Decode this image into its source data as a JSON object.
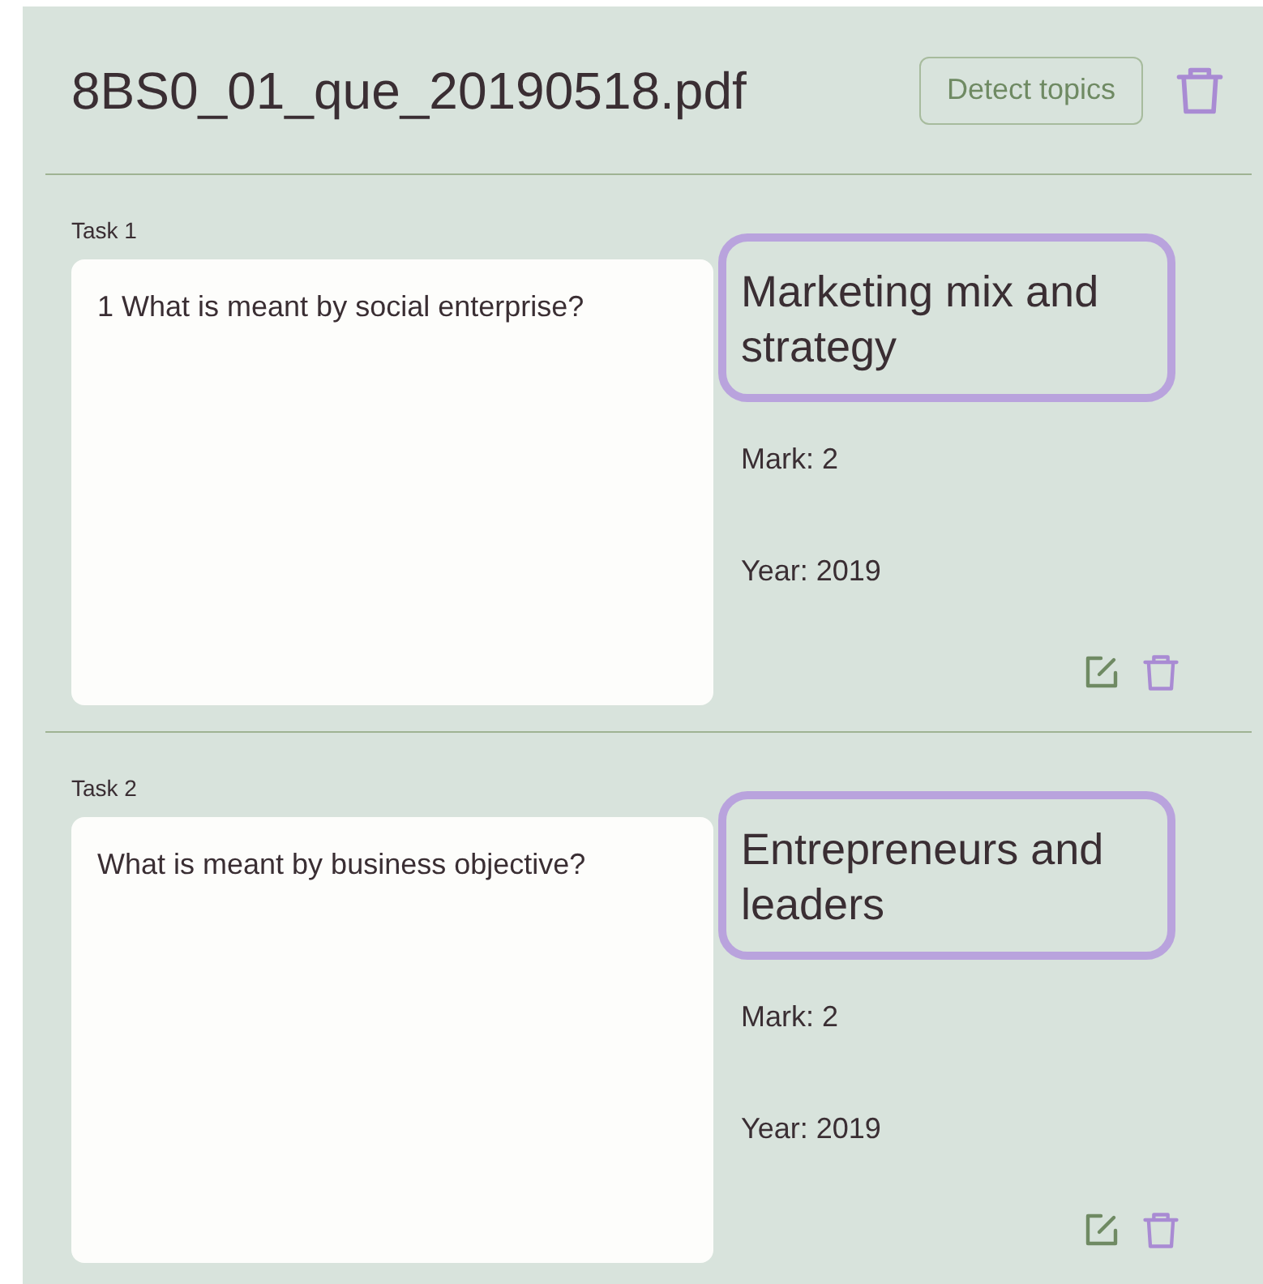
{
  "document": {
    "title": "8BS0_01_que_20190518.pdf",
    "detect_button": "Detect topics"
  },
  "tasks": [
    {
      "label": "Task 1",
      "question": "1 What is meant by social enterprise?",
      "topic": "Marketing mix and strategy",
      "mark": "Mark: 2",
      "year": "Year: 2019"
    },
    {
      "label": "Task 2",
      "question": "What is meant by business objective?",
      "topic": "Entrepreneurs and leaders",
      "mark": "Mark: 2",
      "year": "Year: 2019"
    }
  ]
}
